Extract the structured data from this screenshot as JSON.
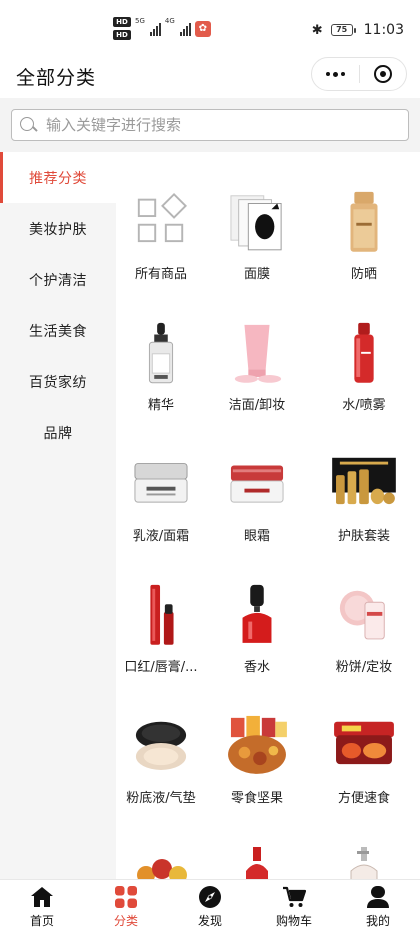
{
  "status_bar": {
    "hd_top": "HD",
    "hd_bottom": "HD",
    "net_5g": "5G",
    "net_4g": "4G",
    "battery": "75",
    "time": "11:03"
  },
  "header": {
    "title": "全部分类"
  },
  "search": {
    "placeholder": "输入关键字进行搜索"
  },
  "sidebar": {
    "items": [
      {
        "label": "推荐分类",
        "active": true
      },
      {
        "label": "美妆护肤",
        "active": false
      },
      {
        "label": "个护清洁",
        "active": false
      },
      {
        "label": "生活美食",
        "active": false
      },
      {
        "label": "百货家纺",
        "active": false
      },
      {
        "label": "品牌",
        "active": false
      }
    ]
  },
  "categories": [
    {
      "label": "所有商品",
      "icon": "grid-diamond-icon"
    },
    {
      "label": "面膜",
      "icon": "face-mask-image"
    },
    {
      "label": "防晒",
      "icon": "sunscreen-image"
    },
    {
      "label": "精华",
      "icon": "serum-image"
    },
    {
      "label": "洁面/卸妆",
      "icon": "cleanser-image"
    },
    {
      "label": "水/喷雾",
      "icon": "toner-image"
    },
    {
      "label": "乳液/面霜",
      "icon": "cream-jar-image"
    },
    {
      "label": "眼霜",
      "icon": "eye-cream-image"
    },
    {
      "label": "护肤套装",
      "icon": "skincare-set-image"
    },
    {
      "label": "口红/唇膏/...",
      "icon": "lipstick-image"
    },
    {
      "label": "香水",
      "icon": "perfume-image"
    },
    {
      "label": "粉饼/定妆",
      "icon": "powder-image"
    },
    {
      "label": "粉底液/气垫",
      "icon": "cushion-image"
    },
    {
      "label": "零食坚果",
      "icon": "snacks-image"
    },
    {
      "label": "方便速食",
      "icon": "instant-food-image"
    },
    {
      "label": "",
      "icon": "fruit-basket-image"
    },
    {
      "label": "",
      "icon": "bottle-image"
    },
    {
      "label": "",
      "icon": "pump-bottle-image"
    }
  ],
  "tabbar": {
    "items": [
      {
        "label": "首页",
        "icon": "home-icon",
        "active": false
      },
      {
        "label": "分类",
        "icon": "category-icon",
        "active": true
      },
      {
        "label": "发现",
        "icon": "compass-icon",
        "active": false
      },
      {
        "label": "购物车",
        "icon": "cart-icon",
        "active": false
      },
      {
        "label": "我的",
        "icon": "user-icon",
        "active": false
      }
    ]
  },
  "colors": {
    "accent": "#e04a3a",
    "sidebar_bg": "#f5f5f5"
  }
}
